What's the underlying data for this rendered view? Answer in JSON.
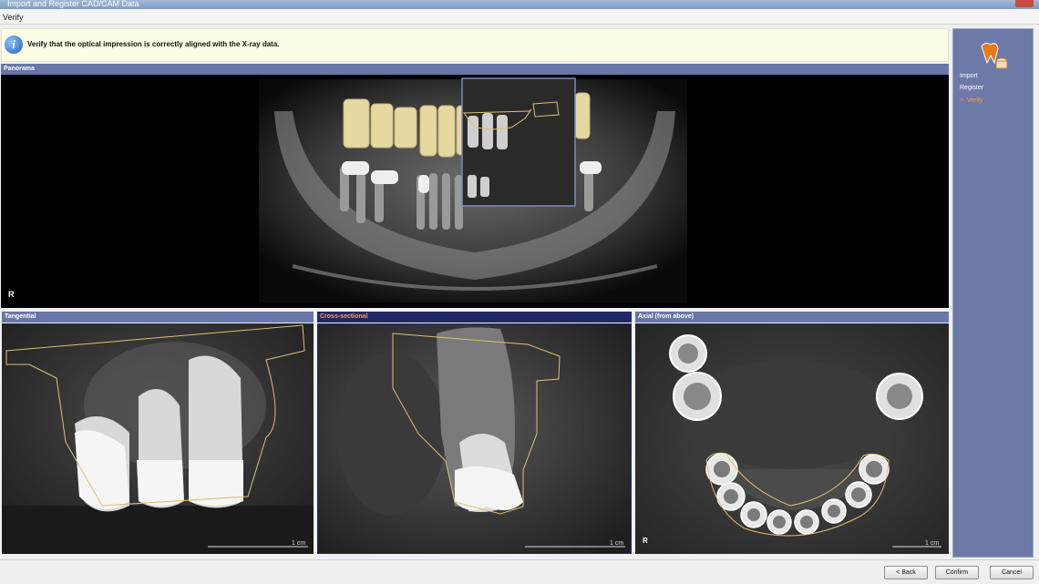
{
  "window": {
    "title": "Import and Register CAD/CAM Data"
  },
  "menu": {
    "label": "Verify"
  },
  "info_banner": {
    "icon": "info-icon",
    "text": "Verify that the optical impression is correctly aligned with the X-ray data."
  },
  "panels": {
    "panorama": {
      "title": "Panorama",
      "side_marker": "R"
    },
    "tangential": {
      "title": "Tangential",
      "scale": "1 cm"
    },
    "cross_sectional": {
      "title": "Cross-sectional",
      "scale": "1 cm"
    },
    "axial": {
      "title": "Axial (from above)",
      "scale": "1 cm",
      "side_marker": "R"
    }
  },
  "sidebar": {
    "icon": "teeth-import-icon",
    "steps": [
      {
        "label": "Import"
      },
      {
        "label": "Register"
      },
      {
        "label": "Verify",
        "current": true
      }
    ],
    "current_marker": ">"
  },
  "buttons": {
    "back": "< Back",
    "confirm": "Confirm",
    "cancel": "Cancel"
  },
  "colors": {
    "header": "#6876a8",
    "header_active": "#202868",
    "active_text": "#ff9b5a",
    "outline": "#e0c070",
    "crown": "#e6d8a0"
  }
}
